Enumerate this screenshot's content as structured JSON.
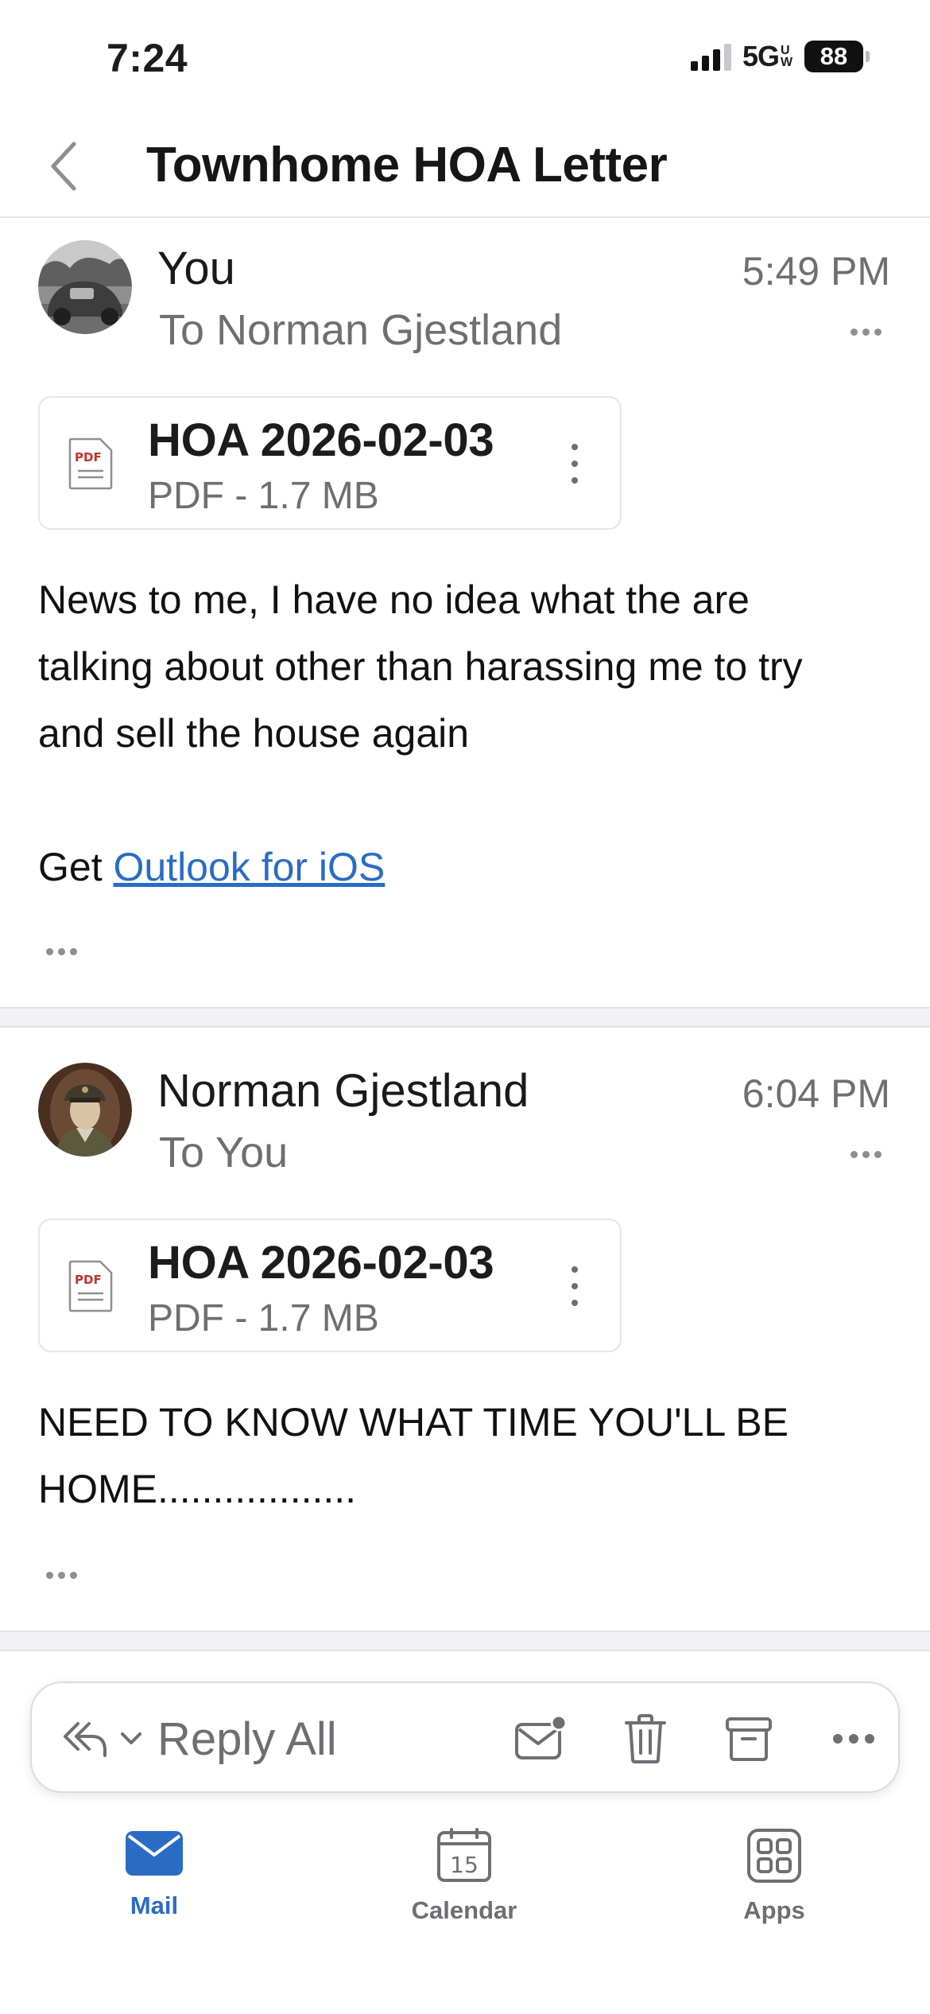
{
  "status_bar": {
    "time": "7:24",
    "network": "5G",
    "network_badge": "UW",
    "battery": "88"
  },
  "header": {
    "title": "Townhome HOA Letter"
  },
  "messages": [
    {
      "sender": "You",
      "recipient": "To Norman Gjestland",
      "time": "5:49 PM",
      "attachment": {
        "name": "HOA 2026-02-03",
        "meta": "PDF - 1.7 MB",
        "icon_text": "PDF"
      },
      "body_lines": [
        "News to me, I have no idea what the are",
        "talking about other than harassing me to try",
        "and sell the house again"
      ],
      "signature_prefix": "Get ",
      "signature_link": "Outlook for iOS"
    },
    {
      "sender": "Norman Gjestland",
      "recipient": "To You",
      "time": "6:04 PM",
      "attachment": {
        "name": "HOA 2026-02-03",
        "meta": "PDF - 1.7 MB",
        "icon_text": "PDF"
      },
      "body_lines": [
        "NEED TO KNOW WHAT TIME YOU'LL BE",
        "HOME.................."
      ]
    }
  ],
  "action_bar": {
    "reply_label": "Reply All",
    "icons": [
      "reply-all-icon",
      "chevron-down-icon",
      "mark-unread-icon",
      "trash-icon",
      "archive-icon",
      "more-icon"
    ]
  },
  "tabs": [
    {
      "label": "Mail",
      "icon": "mail-icon",
      "active": true
    },
    {
      "label": "Calendar",
      "icon": "calendar-icon",
      "day": "15",
      "active": false
    },
    {
      "label": "Apps",
      "icon": "apps-icon",
      "active": false
    }
  ],
  "colors": {
    "accent": "#2a6cc4",
    "secondary_text": "#6e6e73",
    "pdf_red": "#c4312c"
  }
}
